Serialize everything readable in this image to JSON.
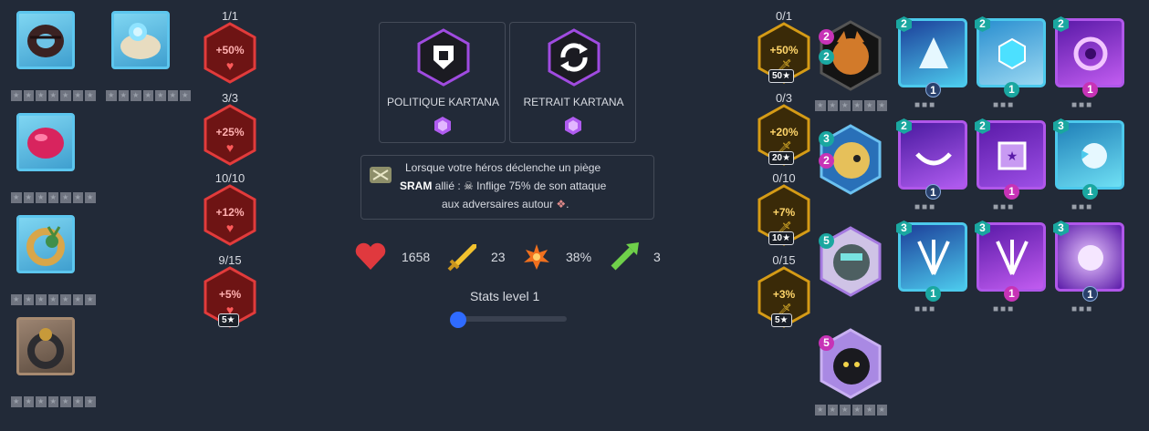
{
  "items": [
    {
      "name": "ring-dark",
      "frame": "blue"
    },
    {
      "name": "shell-spirit",
      "frame": "blue"
    },
    {
      "name": "ring-pink",
      "frame": "blue"
    },
    {
      "name": "ring-gold",
      "frame": "blue"
    },
    {
      "name": "ring-black",
      "frame": "bronze"
    }
  ],
  "red_boosts": [
    {
      "count": "1/1",
      "pct": "+50%"
    },
    {
      "count": "3/3",
      "pct": "+25%"
    },
    {
      "count": "10/10",
      "pct": "+12%"
    },
    {
      "count": "9/15",
      "pct": "+5%",
      "tag": "5★"
    }
  ],
  "cards": [
    {
      "label": "POLITIQUE KARTANA",
      "icon": "crest-icon"
    },
    {
      "label": "RETRAIT KARTANA",
      "icon": "refresh-icon"
    }
  ],
  "description": {
    "line1": "Lorsque votre héros déclenche un piège",
    "line2_bold": "SRAM",
    "line2_rest": " allié : ",
    "line2_tail": " Inflige 75% de son attaque",
    "line3": "aux adversaires autour ",
    "line3_end": "."
  },
  "stats": {
    "hp": "1658",
    "attack": "23",
    "crit": "38%",
    "range": "3",
    "level_label": "Stats level 1",
    "level_value": 1
  },
  "gold_boosts": [
    {
      "count": "0/1",
      "pct": "+50%",
      "tag": "50★"
    },
    {
      "count": "0/3",
      "pct": "+20%",
      "tag": "20★"
    },
    {
      "count": "0/10",
      "pct": "+7%",
      "tag": "10★"
    },
    {
      "count": "0/15",
      "pct": "+3%",
      "tag": "5★"
    }
  ],
  "champions": [
    {
      "name": "fox-rogue",
      "badge1": "2",
      "badge2": "2"
    },
    {
      "name": "blonde-pirate",
      "badge1": "3",
      "badge2": "2"
    },
    {
      "name": "goggle-knight",
      "badge1": "5"
    },
    {
      "name": "black-cat",
      "badge1": "5"
    }
  ],
  "spells": [
    {
      "rank": "2",
      "gem": "1"
    },
    {
      "rank": "2",
      "gem": "1"
    },
    {
      "rank": "2",
      "gem": "1"
    },
    {
      "rank": "2",
      "gem": "1"
    },
    {
      "rank": "2",
      "gem": "1"
    },
    {
      "rank": "3",
      "gem": "1"
    },
    {
      "rank": "3",
      "gem": "1"
    },
    {
      "rank": "3",
      "gem": "1"
    },
    {
      "rank": "3",
      "gem": "1"
    }
  ],
  "colors": {
    "bg": "#222a38",
    "red": "#e23b3b",
    "gold": "#d59b16",
    "blue": "#4cc9ec",
    "purple": "#a04be0"
  }
}
